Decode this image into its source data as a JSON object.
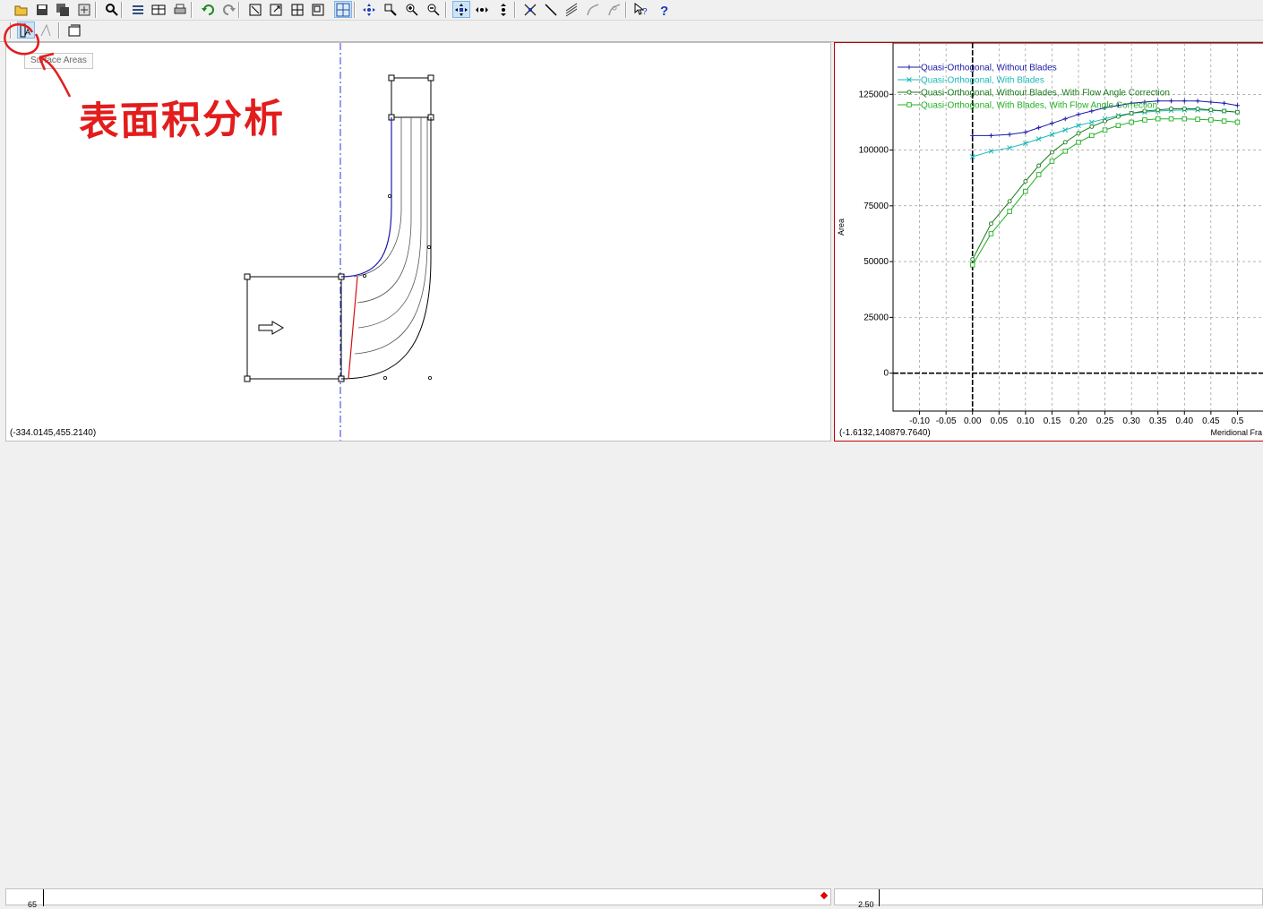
{
  "toolbar": {
    "buttons": [
      {
        "icon": "open-folder-icon"
      },
      {
        "icon": "save-icon"
      },
      {
        "icon": "save-all-icon"
      },
      {
        "icon": "settings-icon"
      },
      {
        "icon": "find-icon"
      },
      {
        "icon": "layers-icon"
      },
      {
        "icon": "table-icon"
      },
      {
        "icon": "print-icon"
      },
      {
        "icon": "undo-icon"
      },
      {
        "icon": "redo-icon"
      },
      {
        "icon": "fit-view-icon"
      },
      {
        "icon": "expand-icon"
      },
      {
        "icon": "split-icon"
      },
      {
        "icon": "window-icon"
      },
      {
        "icon": "grid-icon"
      },
      {
        "icon": "pan-icon"
      },
      {
        "icon": "zoom-box-icon"
      },
      {
        "icon": "zoom-in-icon"
      },
      {
        "icon": "zoom-out-icon"
      },
      {
        "icon": "move-point-icon"
      },
      {
        "icon": "horizontal-move-icon"
      },
      {
        "icon": "vertical-move-icon"
      },
      {
        "icon": "intersect-icon"
      },
      {
        "icon": "line-icon"
      },
      {
        "icon": "layer-stack-icon"
      },
      {
        "icon": "curve-icon"
      },
      {
        "icon": "curve-edit-icon"
      },
      {
        "icon": "context-help-icon"
      },
      {
        "icon": "help-icon"
      }
    ]
  },
  "toolbar2": {
    "buttons": [
      {
        "icon": "surface-areas-icon"
      },
      {
        "icon": "angle-icon"
      },
      {
        "icon": "properties-icon"
      }
    ]
  },
  "tooltip": {
    "text": "Surface Areas"
  },
  "annotation": {
    "text": "表面积分析"
  },
  "left_pane": {
    "coord_readout": "(-334.0145,455.2140)"
  },
  "right_pane": {
    "coord_readout": "(-1.6132,140879.7640)"
  },
  "bottom": {
    "left_label": "65",
    "right_label": "2.50"
  },
  "chart_data": {
    "type": "line",
    "title": "",
    "xlabel": "Meridional Fra",
    "ylabel": "Area",
    "xlim": [
      -0.15,
      0.55
    ],
    "ylim": [
      -17000,
      148000
    ],
    "x_ticks": [
      "-0.10",
      "-0.05",
      "0.00",
      "0.05",
      "0.10",
      "0.15",
      "0.20",
      "0.25",
      "0.30",
      "0.35",
      "0.40",
      "0.45",
      "0.5"
    ],
    "x_tick_values": [
      -0.1,
      -0.05,
      0.0,
      0.05,
      0.1,
      0.15,
      0.2,
      0.25,
      0.3,
      0.35,
      0.4,
      0.45,
      0.5
    ],
    "y_ticks": [
      "0",
      "25000",
      "50000",
      "75000",
      "100000",
      "125000"
    ],
    "y_tick_values": [
      0,
      25000,
      50000,
      75000,
      100000,
      125000
    ],
    "grid": true,
    "legend_position": "top-left",
    "x": [
      0.0,
      0.035,
      0.07,
      0.1,
      0.125,
      0.15,
      0.175,
      0.2,
      0.225,
      0.25,
      0.275,
      0.3,
      0.325,
      0.35,
      0.375,
      0.4,
      0.425,
      0.45,
      0.475,
      0.5
    ],
    "series": [
      {
        "name": "Quasi-Orthogonal, Without Blades",
        "color": "#1a1aa8",
        "marker": "plus",
        "values": [
          106500,
          106500,
          107000,
          108000,
          110000,
          112000,
          114000,
          116000,
          117500,
          119000,
          120000,
          121000,
          121500,
          122000,
          122000,
          122000,
          122000,
          121500,
          121000,
          120000
        ]
      },
      {
        "name": "Quasi-Orthogonal, With Blades",
        "color": "#1ab8b8",
        "marker": "x",
        "values": [
          97000,
          99500,
          101000,
          103000,
          105000,
          107000,
          109000,
          111000,
          112500,
          114000,
          115500,
          116500,
          117000,
          117500,
          117800,
          118000,
          118000,
          117800,
          117500,
          117000
        ]
      },
      {
        "name": "Quasi-Orthogonal, Without Blades, With Flow Angle Correction",
        "color": "#1a7a1a",
        "marker": "circle",
        "values": [
          51000,
          67000,
          77000,
          86000,
          93000,
          99000,
          103500,
          107500,
          110500,
          113000,
          115000,
          116500,
          117500,
          118000,
          118500,
          118500,
          118500,
          118000,
          117500,
          117000
        ]
      },
      {
        "name": "Quasi-Orthogonal, With Blades, With Flow Angle Correction",
        "color": "#22b022",
        "marker": "square",
        "values": [
          48500,
          62500,
          72500,
          81500,
          89000,
          95000,
          99500,
          103500,
          106500,
          109000,
          111000,
          112500,
          113500,
          114000,
          114000,
          114000,
          113800,
          113500,
          113000,
          112500
        ]
      }
    ]
  }
}
